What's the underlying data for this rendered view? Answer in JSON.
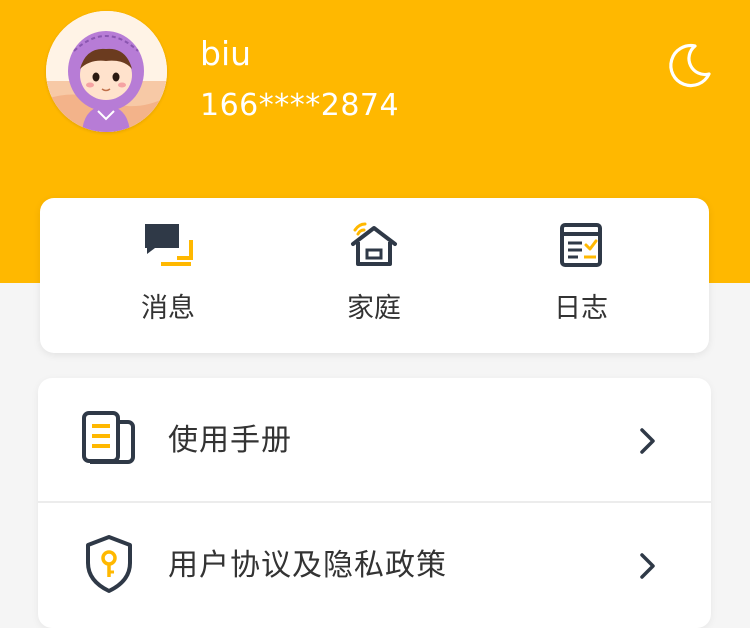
{
  "profile": {
    "username": "biu",
    "phone": "166****2874"
  },
  "header": {
    "theme_icon": "moon-icon"
  },
  "quick_actions": [
    {
      "label": "消息",
      "icon": "message-icon"
    },
    {
      "label": "家庭",
      "icon": "home-icon"
    },
    {
      "label": "日志",
      "icon": "log-icon"
    }
  ],
  "menu": [
    {
      "label": "使用手册",
      "icon": "manual-icon"
    },
    {
      "label": "用户协议及隐私政策",
      "icon": "privacy-shield-icon"
    }
  ],
  "colors": {
    "brand": "#ffb800",
    "icon_dark": "#2f3947",
    "background": "#f5f5f5",
    "card": "#ffffff"
  }
}
